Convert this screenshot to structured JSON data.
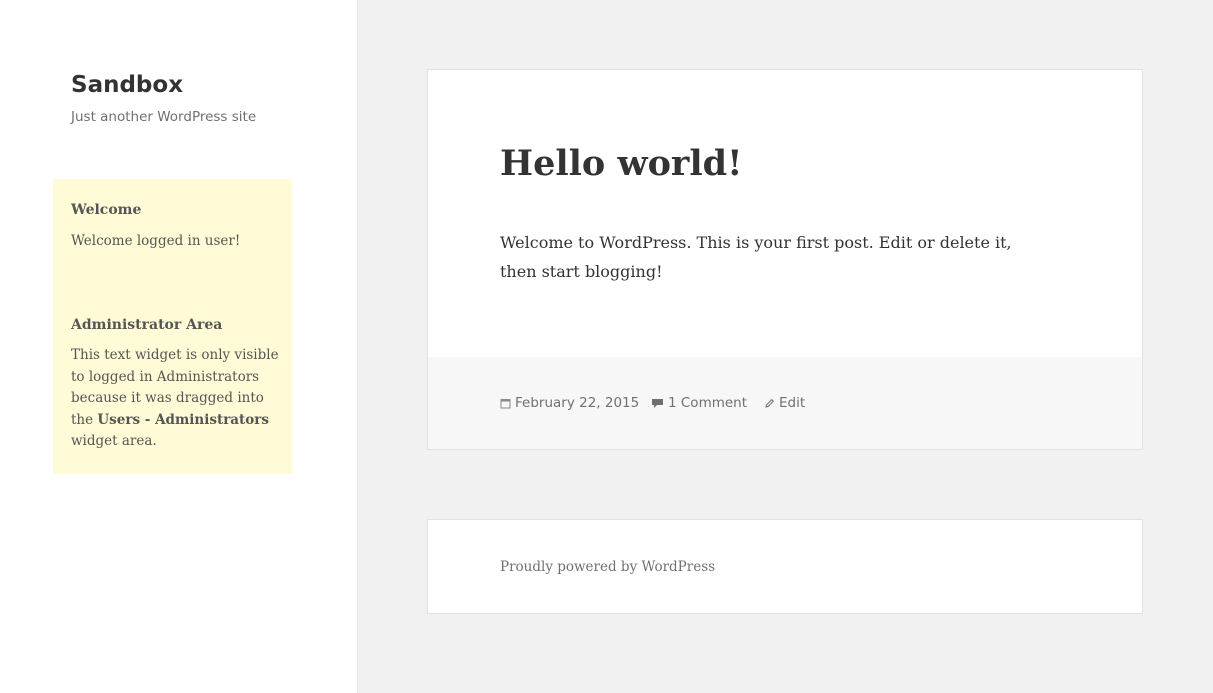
{
  "site": {
    "title": "Sandbox",
    "description": "Just another WordPress site"
  },
  "widgets": [
    {
      "title": "Welcome",
      "text": "Welcome logged in user!"
    },
    {
      "title": "Administrator Area",
      "text_before": "This text widget is only visible to logged in Administrators because it was dragged into the ",
      "text_strong": "Users - Administrators",
      "text_after": " widget area."
    }
  ],
  "post": {
    "title": "Hello world!",
    "content": "Welcome to WordPress. This is your first post. Edit or delete it, then start blogging!",
    "date": "February 22, 2015",
    "comments": "1 Comment",
    "edit": "Edit"
  },
  "footer": {
    "text": "Proudly powered by WordPress"
  },
  "icons": {
    "date": "calendar-icon",
    "comments": "comment-icon",
    "edit": "pencil-icon"
  },
  "colors": {
    "page_background": "#f1f1f1",
    "widget_background": "#fffbd6",
    "card_background": "#ffffff",
    "footer_band": "#f7f7f7"
  }
}
